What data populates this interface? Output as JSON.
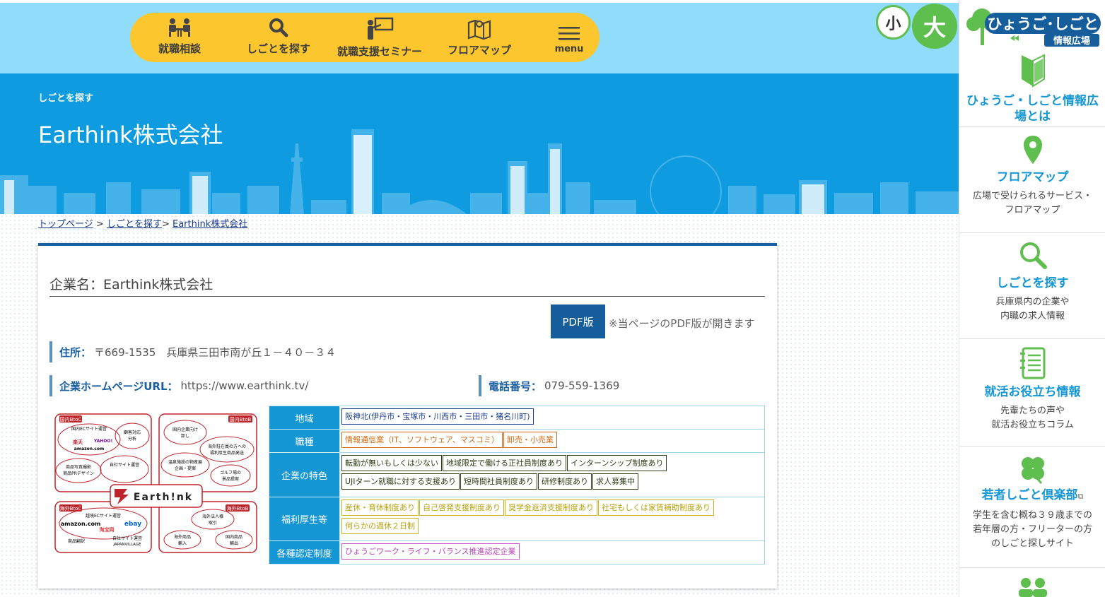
{
  "nav": {
    "items": [
      {
        "label": "就職相談",
        "icon": "consultation-icon"
      },
      {
        "label": "しごとを探す",
        "icon": "search-icon"
      },
      {
        "label": "就職支援セミナー",
        "icon": "seminar-icon"
      },
      {
        "label": "フロアマップ",
        "icon": "map-icon"
      }
    ],
    "menu_label": "menu"
  },
  "font_size": {
    "small": "小",
    "large": "大"
  },
  "hero": {
    "subtitle": "しごとを探す",
    "title": "Earthink株式会社"
  },
  "breadcrumb": {
    "home": "トップページ",
    "sep": ">",
    "search": "しごとを探す",
    "current": "Earthink株式会社"
  },
  "company": {
    "name_label": "企業名：Earthink株式会社",
    "pdf_button": "PDF版",
    "pdf_note": "※当ページのPDF版が開きます",
    "address_key": "住所：",
    "address_value": "〒669-1535　兵庫県三田市南が丘１－４０－３４",
    "url_key": "企業ホームページURL：",
    "url_value": "https://www.earthink.tv/",
    "phone_key": "電話番号：",
    "phone_value": "079-559-1369"
  },
  "diagram": {
    "q1_label": "国内BtoC",
    "q2_label": "国内BtoB",
    "q3_label": "海外BtoC",
    "q4_label": "海外BtoB",
    "q1_items": [
      "国内ECサイト運営",
      "顧客対応",
      "分析",
      "楽天",
      "YAHOO!",
      "amazon.com",
      "商品写真撮影",
      "商品PRデザイン",
      "自社サイト運営"
    ],
    "q2_items": [
      "国内企業向け",
      "卸し",
      "海外駐在員の方への",
      "福利厚生商品発送",
      "温泉施設の物産展",
      "企画・提案",
      "ゴルフ場の",
      "景品提案"
    ],
    "q3_items": [
      "越境ECサイト運営",
      "amazon.com",
      "ebay",
      "淘宝网",
      "商品翻訳",
      "自社サイト運営",
      "JAPANVILLAGE"
    ],
    "q4_items": [
      "海外法人様",
      "取引",
      "海外商品",
      "輸入",
      "国内商品",
      "輸出"
    ],
    "logo_text": "Earth!nk"
  },
  "attributes": [
    {
      "label": "地域",
      "kind": "area",
      "tags": [
        "阪神北(伊丹市・宝塚市・川西市・三田市・猪名川町)"
      ]
    },
    {
      "label": "職種",
      "kind": "ind",
      "tags": [
        "情報通信業（IT、ソフトウェア、マスコミ）",
        "卸売・小売業"
      ]
    },
    {
      "label": "企業の特色",
      "kind": "feat",
      "tags": [
        "転勤が無いもしくは少ない",
        "地域限定で働ける正社員制度あり",
        "インターンシップ制度あり",
        "UJIターン就職に対する支援あり",
        "短時間社員制度あり",
        "研修制度あり",
        "求人募集中"
      ]
    },
    {
      "label": "福利厚生等",
      "kind": "wel",
      "tags": [
        "産休・育休制度あり",
        "自己啓発支援制度あり",
        "奨学金返済支援制度あり",
        "社宅もしくは家賃補助制度あり",
        "何らかの週休２日制"
      ]
    },
    {
      "label": "各種認定制度",
      "kind": "cert",
      "tags": [
        "ひょうごワーク・ライフ・バランス推進認定企業"
      ]
    }
  ],
  "sidebar": {
    "logo_line1": "ひょうご･しごと",
    "logo_line2": "情報広場",
    "items": [
      {
        "title1": "ひょうご・しごと情報広",
        "title2": "場とは",
        "icon": "beginner-mark-icon"
      },
      {
        "title": "フロアマップ",
        "desc1": "広場で受けられるサービス・",
        "desc2": "フロアマップ",
        "icon": "map-pin-icon"
      },
      {
        "title": "しごとを探す",
        "desc1": "兵庫県内の企業や",
        "desc2": "内職の求人情報",
        "icon": "magnifier-icon"
      },
      {
        "title": "就活お役立ち情報",
        "desc1": "先輩たちの声や",
        "desc2": "就活お役立ちコラム",
        "icon": "notebook-icon"
      },
      {
        "title": "若者しごと倶楽部",
        "desc1": "学生を含む概ね３９歳までの",
        "desc2": "若年層の方・フリーターの方",
        "desc3": "のしごと探しサイト",
        "icon": "clover-icon"
      }
    ]
  },
  "colors": {
    "accent_yellow": "#fcc62e",
    "hero_blue": "#0f9be0",
    "sky_blue": "#8fdcfb",
    "green": "#5fbf4e",
    "navy": "#155d9b"
  }
}
